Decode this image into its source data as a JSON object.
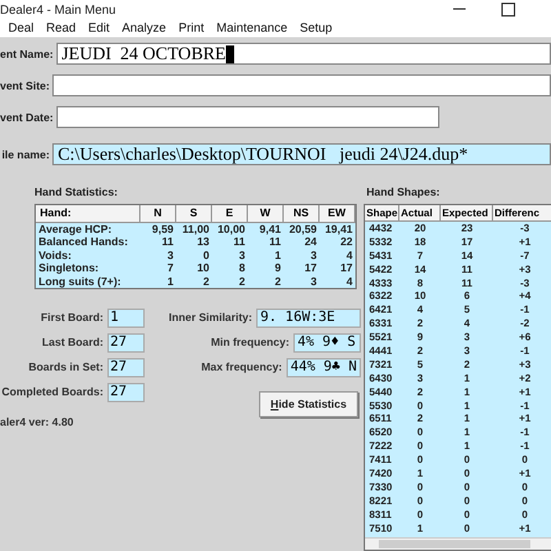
{
  "window": {
    "title": "Dealer4 - Main Menu"
  },
  "menu": [
    "Deal",
    "Read",
    "Edit",
    "Analyze",
    "Print",
    "Maintenance",
    "Setup"
  ],
  "event_fields": [
    {
      "label": "ent Name:",
      "value": "JEUDI  24 OCTOBRE",
      "caret": true,
      "wide": true
    },
    {
      "label": "vent Site:",
      "caret": false,
      "wide": true
    },
    {
      "label": "vent Date:",
      "caret": false,
      "wide": false
    }
  ],
  "file_name": {
    "label": "ile name:",
    "value": "C:\\Users\\charles\\Desktop\\TOURNOI   jeudi 24\\J24.dup*"
  },
  "hand_statistics": {
    "title": "Hand Statistics:",
    "columns": [
      "Hand:",
      "N",
      "S",
      "E",
      "W",
      "NS",
      "EW"
    ],
    "rows": [
      [
        "Average HCP:",
        "9,59",
        "11,00",
        "10,00",
        "9,41",
        "20,59",
        "19,41"
      ],
      [
        "Balanced Hands:",
        "11",
        "13",
        "11",
        "11",
        "24",
        "22"
      ],
      [
        "Voids:",
        "3",
        "0",
        "3",
        "1",
        "3",
        "4"
      ],
      [
        "Singletons:",
        "7",
        "10",
        "8",
        "9",
        "17",
        "17"
      ],
      [
        "Long suits (7+):",
        "1",
        "2",
        "2",
        "2",
        "3",
        "4"
      ]
    ]
  },
  "board_fields": [
    {
      "label": "First Board:",
      "value": "1"
    },
    {
      "label": "Last Board:",
      "value": "27"
    },
    {
      "label": "Boards in Set:",
      "value": "27"
    },
    {
      "label": "Completed Boards:",
      "value": "27"
    }
  ],
  "similarity_fields": [
    {
      "label": "Inner Similarity:",
      "value": "9. 16W:3E"
    },
    {
      "label": "Min frequency:",
      "value": "4% 9♦ S"
    },
    {
      "label": "Max frequency:",
      "value": "44% 9♣ N"
    }
  ],
  "hide_button": "Hide Statistics",
  "version": "aler4  ver: 4.80",
  "hand_shapes": {
    "title": "Hand Shapes:",
    "columns": [
      "Shape",
      "Actual",
      "Expected",
      "Differenc"
    ],
    "rows": [
      [
        "4432",
        "20",
        "23",
        "-3"
      ],
      [
        "5332",
        "18",
        "17",
        "+1"
      ],
      [
        "5431",
        "7",
        "14",
        "-7"
      ],
      [
        "5422",
        "14",
        "11",
        "+3"
      ],
      [
        "4333",
        "8",
        "11",
        "-3"
      ],
      [
        "6322",
        "10",
        "6",
        "+4"
      ],
      [
        "6421",
        "4",
        "5",
        "-1"
      ],
      [
        "6331",
        "2",
        "4",
        "-2"
      ],
      [
        "5521",
        "9",
        "3",
        "+6"
      ],
      [
        "4441",
        "2",
        "3",
        "-1"
      ],
      [
        "7321",
        "5",
        "2",
        "+3"
      ],
      [
        "6430",
        "3",
        "1",
        "+2"
      ],
      [
        "5440",
        "2",
        "1",
        "+1"
      ],
      [
        "5530",
        "0",
        "1",
        "-1"
      ],
      [
        "6511",
        "2",
        "1",
        "+1"
      ],
      [
        "6520",
        "0",
        "1",
        "-1"
      ],
      [
        "7222",
        "0",
        "1",
        "-1"
      ],
      [
        "7411",
        "0",
        "0",
        "0"
      ],
      [
        "7420",
        "1",
        "0",
        "+1"
      ],
      [
        "7330",
        "0",
        "0",
        "0"
      ],
      [
        "8221",
        "0",
        "0",
        "0"
      ],
      [
        "8311",
        "0",
        "0",
        "0"
      ],
      [
        "7510",
        "1",
        "0",
        "+1"
      ]
    ]
  }
}
